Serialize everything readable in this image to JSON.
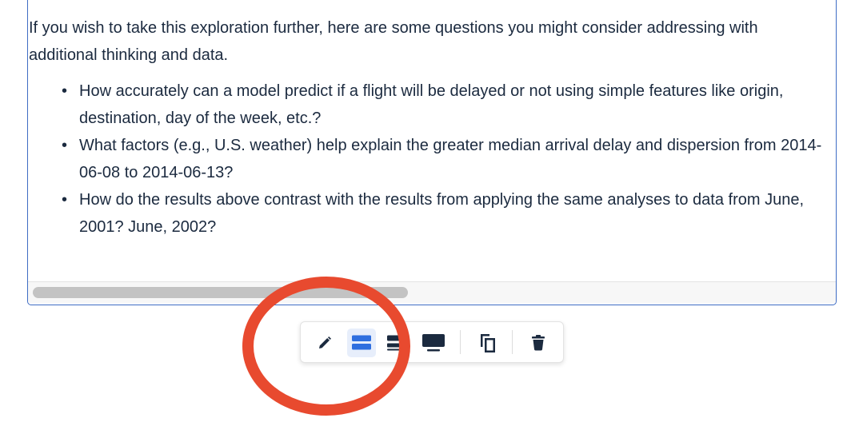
{
  "notebook_cell": {
    "intro_text": "If you wish to take this exploration further, here are some questions you might consider addressing with additional thinking and data.",
    "bullet_glyph": "•",
    "questions": [
      "How accurately can a model predict if a flight will be delayed or not using simple features like origin, destination, day of the week, etc.?",
      "What factors (e.g., U.S. weather) help explain the greater median arrival delay and dispersion from 2014-06-08 to 2014-06-13?",
      "How do the results above contrast with the results from applying the same analyses to data from June, 2001? June, 2002?"
    ],
    "scrollbar": {
      "thumb_fraction": 0.47
    }
  },
  "toolbar": {
    "buttons": [
      {
        "name": "edit",
        "icon": "pencil-icon",
        "active": false
      },
      {
        "name": "layout-default",
        "icon": "layout-default-icon",
        "active": true
      },
      {
        "name": "layout-side-by-side",
        "icon": "layout-side-icon",
        "active": false
      },
      {
        "name": "present",
        "icon": "monitor-icon",
        "active": false
      },
      {
        "name": "duplicate",
        "icon": "copy-icon",
        "active": false
      },
      {
        "name": "delete",
        "icon": "trash-icon",
        "active": false
      }
    ]
  },
  "colors": {
    "text": "#1b2a3f",
    "cell_border": "#3e6cc4",
    "icon_dark": "#1b2a3f",
    "icon_active": "#2f6fdf",
    "active_bg": "#e7eefb",
    "annotation_red": "#e84a2f",
    "scroll_thumb": "#c3c3c3"
  }
}
